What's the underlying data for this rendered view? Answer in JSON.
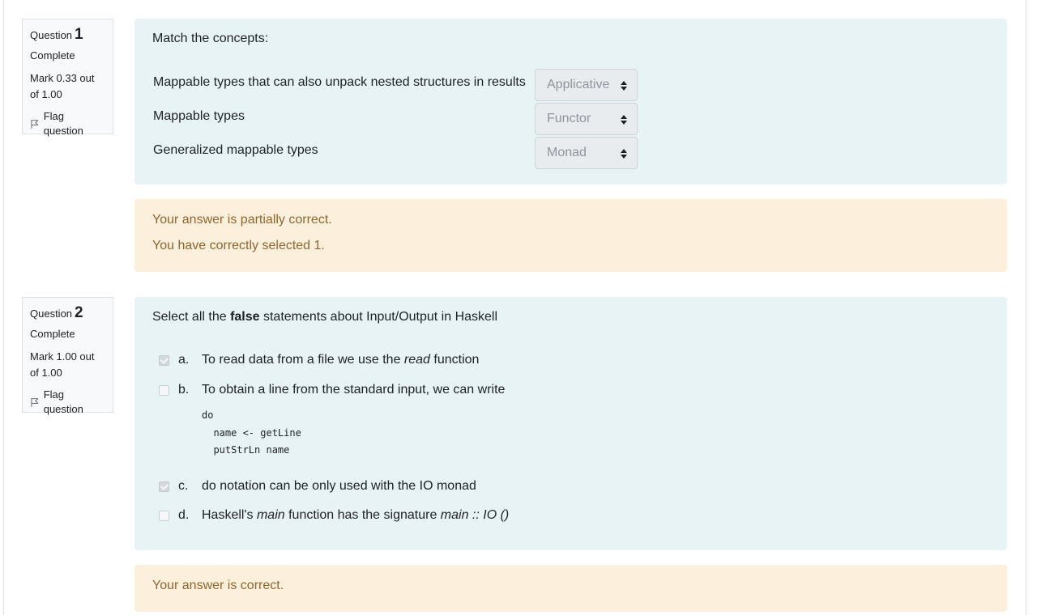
{
  "q1": {
    "label": "Question",
    "number": "1",
    "state": "Complete",
    "grade": "Mark 0.33 out of 1.00",
    "flag_label": "Flag question",
    "text": "Match the concepts:",
    "rows": [
      {
        "stem": "Mappable types that can also unpack nested structures in results",
        "selected": "Applicative"
      },
      {
        "stem": "Mappable types",
        "selected": "Functor"
      },
      {
        "stem": "Generalized mappable types",
        "selected": "Monad"
      }
    ],
    "feedback_1": "Your answer is partially correct.",
    "feedback_2": "You have correctly selected 1."
  },
  "q2": {
    "label": "Question",
    "number": "2",
    "state": "Complete",
    "grade": "Mark 1.00 out of 1.00",
    "flag_label": "Flag question",
    "text_pre": "Select all the ",
    "text_bold": "false",
    "text_post": " statements about Input/Output in Haskell",
    "options": [
      {
        "letter": "a.",
        "checked": true,
        "t1": "To read data from a file we use the ",
        "t1_em": "read",
        "t1_post": " function"
      },
      {
        "letter": "b.",
        "checked": false,
        "t1": "To obtain a line from the standard input, we can write"
      },
      {
        "letter": "c.",
        "checked": true,
        "t1": "do notation can be only used with the IO monad"
      },
      {
        "letter": "d.",
        "checked": false,
        "t1": "Haskell's ",
        "t1_em": "main",
        "t1_mid": " function has the signature ",
        "t1_em2": "main :: IO ()"
      }
    ],
    "code_lines": [
      "do",
      "  name <- getLine",
      "  putStrLn name"
    ],
    "feedback_1": "Your answer is correct."
  },
  "colors": {
    "formulation_bg": "#e7f3f5",
    "feedback_bg": "#fcefdc",
    "feedback_text": "#8e662e"
  },
  "icons": {
    "flag": "flag-icon",
    "select_arrows": "sort-arrows-icon"
  }
}
